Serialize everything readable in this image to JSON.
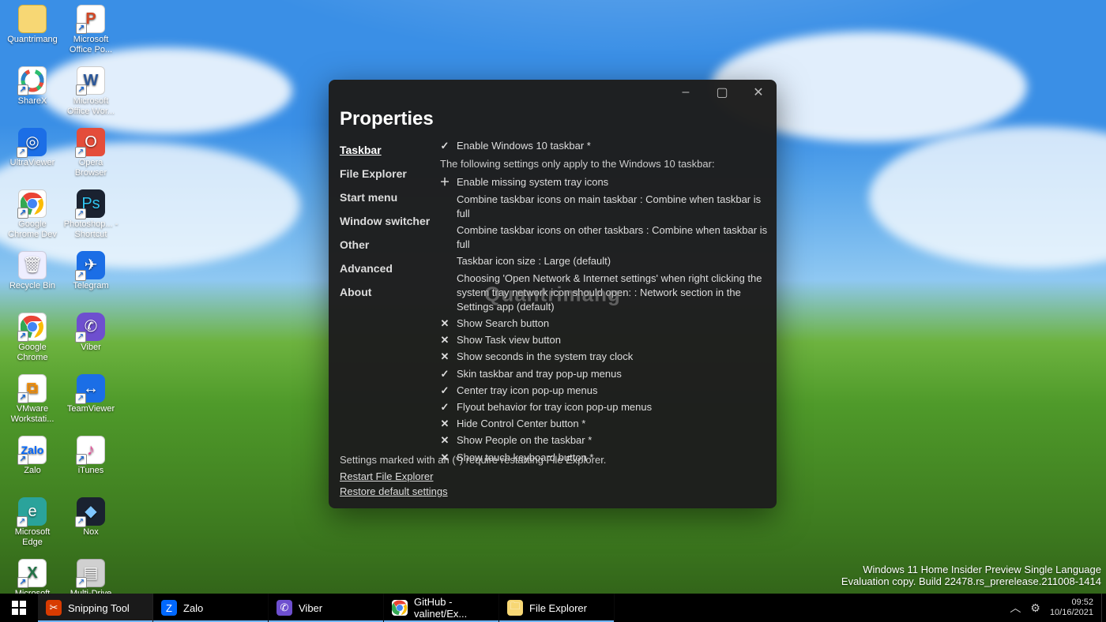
{
  "desktop_icons": [
    [
      {
        "name": "Quantrimang",
        "icon": "folder"
      },
      {
        "name": "Microsoft Office Po...",
        "icon": "white",
        "glyph": "P",
        "glyphColor": "#d24726",
        "shortcut": true
      }
    ],
    [
      {
        "name": "ShareX",
        "icon": "white",
        "svg": "sharex",
        "shortcut": true
      },
      {
        "name": "Microsoft Office Wor...",
        "icon": "white",
        "glyph": "W",
        "glyphColor": "#2b579a",
        "shortcut": true
      }
    ],
    [
      {
        "name": "UltraViewer",
        "icon": "blue",
        "glyph": "◎",
        "shortcut": true
      },
      {
        "name": "Opera Browser",
        "icon": "red",
        "glyph": "O",
        "shortcut": true
      }
    ],
    [
      {
        "name": "Google Chrome Dev",
        "icon": "white",
        "svg": "chrome",
        "shortcut": true
      },
      {
        "name": "Photoshop... - Shortcut",
        "icon": "dark",
        "glyph": "Ps",
        "glyphColor": "#31c5f0",
        "shortcut": true
      }
    ],
    [
      {
        "name": "Recycle Bin",
        "icon": "bin",
        "glyph": "🗑"
      },
      {
        "name": "Telegram",
        "icon": "blue",
        "glyph": "✈",
        "shortcut": true
      }
    ],
    [
      {
        "name": "Google Chrome",
        "icon": "white",
        "svg": "chrome",
        "shortcut": true
      },
      {
        "name": "Viber",
        "icon": "purple",
        "glyph": "✆",
        "shortcut": true
      }
    ],
    [
      {
        "name": "VMware Workstati...",
        "icon": "white",
        "glyph": "⧉",
        "glyphColor": "#f38b00",
        "shortcut": true
      },
      {
        "name": "TeamViewer",
        "icon": "blue",
        "glyph": "↔",
        "shortcut": true
      }
    ],
    [
      {
        "name": "Zalo",
        "icon": "zalo",
        "glyph": "Zalo",
        "shortcut": true
      },
      {
        "name": "iTunes",
        "icon": "white",
        "glyph": "♪",
        "glyphColor": "#e84f9a",
        "shortcut": true
      }
    ],
    [
      {
        "name": "Microsoft Edge",
        "icon": "teal",
        "glyph": "e",
        "shortcut": true
      },
      {
        "name": "Nox",
        "icon": "dark",
        "glyph": "◆",
        "glyphColor": "#7fc6ff",
        "shortcut": true
      }
    ],
    [
      {
        "name": "Microsoft Office Exc...",
        "icon": "white",
        "glyph": "X",
        "glyphColor": "#217346",
        "shortcut": true
      },
      {
        "name": "Multi-Drive",
        "icon": "gray",
        "glyph": "▤",
        "shortcut": true
      }
    ]
  ],
  "window": {
    "title": "Properties",
    "watermark": "Quantrimang",
    "controls": {
      "min": "–",
      "max": "▢",
      "close": "✕"
    },
    "sidebar": [
      {
        "label": "Taskbar",
        "active": true
      },
      {
        "label": "File Explorer"
      },
      {
        "label": "Start menu"
      },
      {
        "label": "Window switcher"
      },
      {
        "label": "Other"
      },
      {
        "label": "Advanced"
      },
      {
        "label": "About"
      }
    ],
    "intro_lead": {
      "mark": "✓",
      "text": "Enable Windows 10 taskbar *"
    },
    "intro_note": "The following settings only apply to the Windows 10 taskbar:",
    "options": [
      {
        "mark": "＋",
        "text": "Enable missing system tray icons"
      },
      {
        "mark": "",
        "text": "Combine taskbar icons on main taskbar : Combine when taskbar is full"
      },
      {
        "mark": "",
        "text": "Combine taskbar icons on other taskbars : Combine when taskbar is full"
      },
      {
        "mark": "",
        "text": "Taskbar icon size : Large (default)"
      },
      {
        "mark": "",
        "text": "Choosing 'Open Network & Internet settings' when right clicking the system tray network icon should open: : Network section in the Settings app (default)"
      },
      {
        "mark": "✕",
        "text": "Show Search button"
      },
      {
        "mark": "✕",
        "text": "Show Task view button"
      },
      {
        "mark": "✕",
        "text": "Show seconds in the system tray clock"
      },
      {
        "mark": "✓",
        "text": "Skin taskbar and tray pop-up menus"
      },
      {
        "mark": "✓",
        "text": "Center tray icon pop-up menus"
      },
      {
        "mark": "✓",
        "text": "Flyout behavior for tray icon pop-up menus"
      },
      {
        "mark": "✕",
        "text": "Hide Control Center button *"
      },
      {
        "mark": "✕",
        "text": "Show People on the taskbar *"
      },
      {
        "mark": "✕",
        "text": "Show touch keyboard button *"
      }
    ],
    "footer": {
      "note": "Settings marked with an (*) require restarting File Explorer.",
      "link1": "Restart File Explorer",
      "link2": "Restore default settings"
    }
  },
  "os_watermark": {
    "line1": "Windows 11 Home Insider Preview Single Language",
    "line2": "Evaluation copy. Build 22478.rs_prerelease.211008-1414"
  },
  "taskbar": {
    "items": [
      {
        "label": "Snipping Tool",
        "active": true,
        "bg": "#d83b01",
        "glyph": "✂"
      },
      {
        "label": "Zalo",
        "bg": "#0068ff",
        "glyph": "Z"
      },
      {
        "label": "Viber",
        "bg": "#6e4fcf",
        "glyph": "✆"
      },
      {
        "label": "GitHub - valinet/Ex...",
        "bg": "#fff",
        "svg": "chrome"
      },
      {
        "label": "File Explorer",
        "bg": "#f7d774",
        "glyph": "🗀"
      }
    ],
    "clock": {
      "time": "09:52",
      "date": "10/16/2021"
    },
    "tray": {
      "chevron": "︿",
      "gear": "⚙"
    }
  }
}
